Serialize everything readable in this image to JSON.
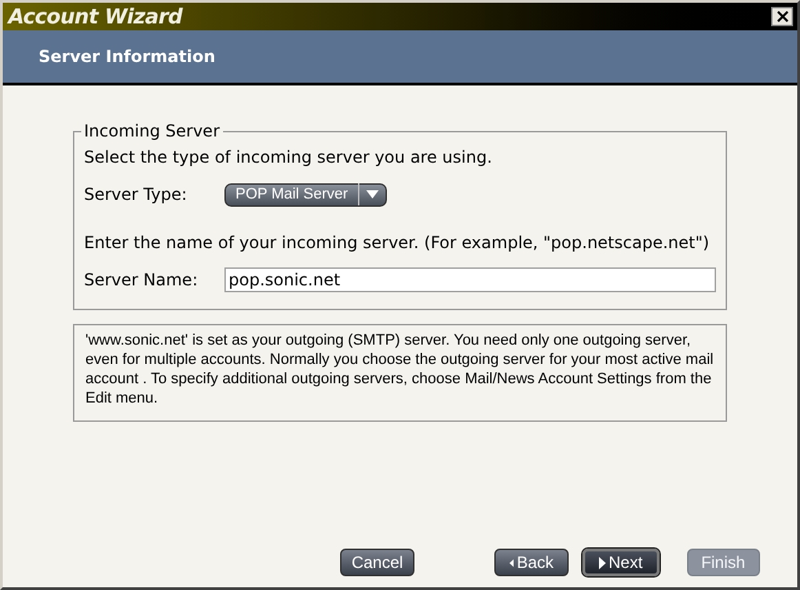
{
  "window": {
    "title": "Account Wizard"
  },
  "header": {
    "title": "Server Information"
  },
  "incoming": {
    "legend": "Incoming Server",
    "type_prompt": "Select the type of incoming server you are using.",
    "type_label": "Server Type:",
    "type_value": "POP Mail Server",
    "name_prompt": "Enter the name of your incoming server. (For example, \"pop.netscape.net\")",
    "name_label": "Server Name:",
    "name_value": "pop.sonic.net"
  },
  "info": "'www.sonic.net' is  set as your outgoing (SMTP) server. You need only one outgoing server, even for multiple accounts. Normally you choose the outgoing server for your most active mail account . To specify additional outgoing servers, choose Mail/News Account Settings from the Edit menu.",
  "buttons": [
    {
      "label": "Cancel",
      "kind": "plain",
      "default": false,
      "disabled": false
    },
    {
      "label": "Back",
      "kind": "back",
      "default": false,
      "disabled": false
    },
    {
      "label": "Next",
      "kind": "next",
      "default": true,
      "disabled": false
    },
    {
      "label": "Finish",
      "kind": "plain",
      "default": false,
      "disabled": true
    }
  ]
}
